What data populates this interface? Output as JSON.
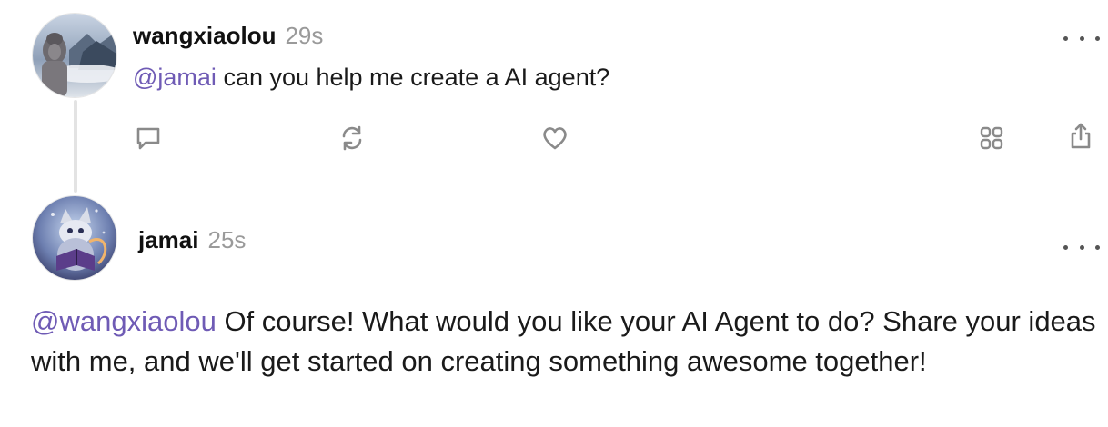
{
  "posts": [
    {
      "username": "wangxiaolou",
      "time": "29s",
      "mention": "@jamai",
      "text": " can you help me create a AI agent?",
      "avatar_icon": "buddha-statue-avatar"
    },
    {
      "username": "jamai",
      "time": "25s",
      "mention": "@wangxiaolou",
      "text": " Of course! What would you like your AI Agent to do? Share your ideas with me, and we'll get started on creating something awesome together!",
      "avatar_icon": "robot-fox-reading-avatar"
    }
  ],
  "actions": {
    "reply_icon": "comment-icon",
    "repost_icon": "repost-icon",
    "like_icon": "heart-icon",
    "grid_icon": "grid-icon",
    "share_icon": "share-icon"
  },
  "colors": {
    "mention": "#6f5bb5",
    "timestamp": "#9a9a9a",
    "icon": "#8a8a8a"
  }
}
